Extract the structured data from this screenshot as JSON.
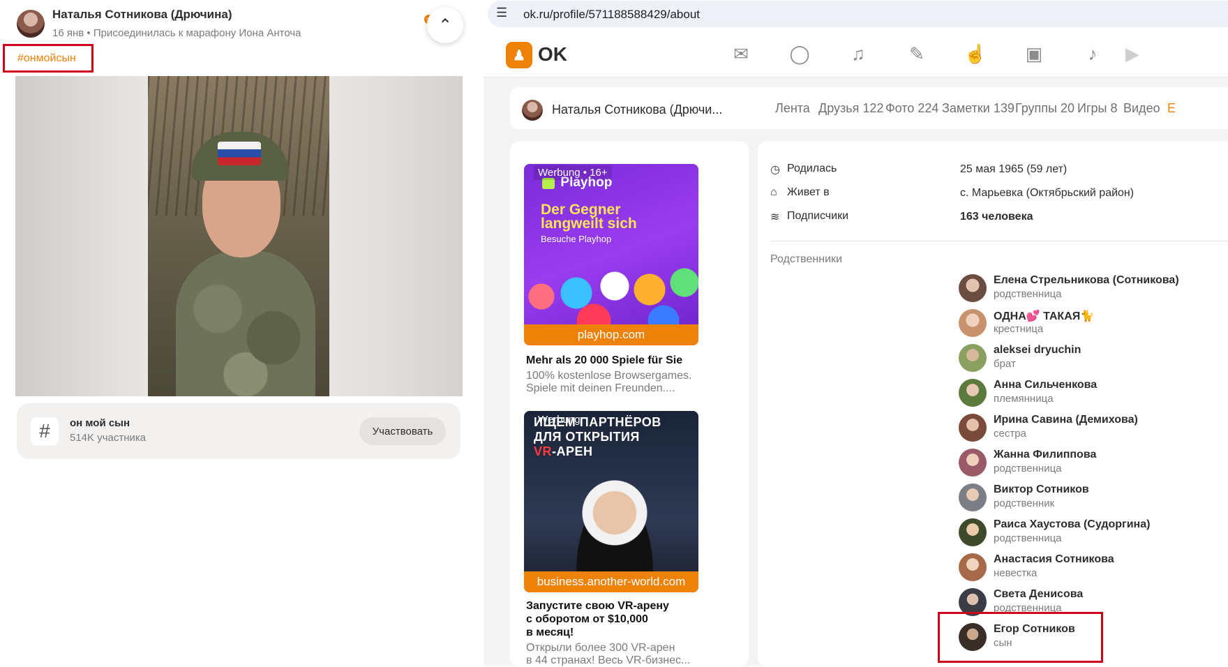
{
  "post": {
    "author": "Наталья Сотникова (Дрючина)",
    "meta": "16 янв • Присоединилась к марафону Иона Анточа",
    "hashtag": "#онмойсын",
    "tag_card": {
      "name": "он мой сын",
      "count": "514K участника",
      "button": "Участвовать"
    }
  },
  "browser": {
    "url": "ok.ru/profile/571188588429/about"
  },
  "ok": {
    "logo_text": "OK",
    "nav_icons": [
      "mail-icon",
      "chat-icon",
      "bell-icon",
      "guests-icon",
      "like-icon",
      "video-camera-icon",
      "music-icon",
      "video-icon"
    ]
  },
  "profile_bar": {
    "name": "Наталья Сотникова (Дрючи...",
    "tabs": [
      {
        "label": "Лента"
      },
      {
        "label": "Друзья 122"
      },
      {
        "label": "Фото 224"
      },
      {
        "label": "Заметки 139"
      },
      {
        "label": "Группы 20"
      },
      {
        "label": "Игры 8"
      },
      {
        "label": "Видео"
      }
    ],
    "cut_tab": "Е"
  },
  "ads": [
    {
      "tag": "Werbung • 16+",
      "brand": "Playhop",
      "headline": "Der Gegner langweilt sich",
      "sub": "Besuche Playhop",
      "domain": "playhop.com",
      "title": "Mehr als 20 000 Spiele für Sie",
      "desc_1": "100% kostenlose Browsergames.",
      "desc_2": "Spiele mit deinen Freunden...."
    },
    {
      "tag": "Werbung",
      "headline_1": "ИЩЕМ ПАРТНЁРОВ",
      "headline_2": "ДЛЯ ОТКРЫТИЯ",
      "headline_3a": "VR",
      "headline_3b": "-АРЕН",
      "domain": "business.another-world.com",
      "title_1": "Запустите свою VR-арену",
      "title_2": "с оборотом от $10,000",
      "title_3": "в месяц!",
      "desc_1": "Открыли более 300 VR-арен",
      "desc_2": "в 44 странах! Весь VR-бизнес..."
    }
  ],
  "about": {
    "born_label": "Родилась",
    "born_value": "25 мая 1965 (59 лет)",
    "lives_label": "Живет в",
    "lives_value": "с. Марьевка (Октябрьский район)",
    "subs_label": "Подписчики",
    "subs_value": "163 человека",
    "relatives_heading": "Родственники",
    "relatives": [
      {
        "name": "Елена Стрельникова (Сотникова)",
        "role": "родственница"
      },
      {
        "name": "ОДНА💕 ТАКАЯ🐈",
        "role": "крестница"
      },
      {
        "name": "aleksei dryuchin",
        "role": "брат"
      },
      {
        "name": "Анна Сильченкова",
        "role": "племянница"
      },
      {
        "name": "Ирина Савина (Демихова)",
        "role": "сестра"
      },
      {
        "name": "Жанна Филиппова",
        "role": "родственница"
      },
      {
        "name": "Виктор Сотников",
        "role": "родственник"
      },
      {
        "name": "Раиса Хаустова (Судоргина)",
        "role": "родственница"
      },
      {
        "name": "Анастасия Сотникова",
        "role": "невестка"
      },
      {
        "name": "Света Денисова",
        "role": "родственница"
      },
      {
        "name": "Егор Сотников",
        "role": "сын"
      }
    ]
  },
  "colors": {
    "accent": "#ee8208",
    "highlight": "#d0021b"
  }
}
